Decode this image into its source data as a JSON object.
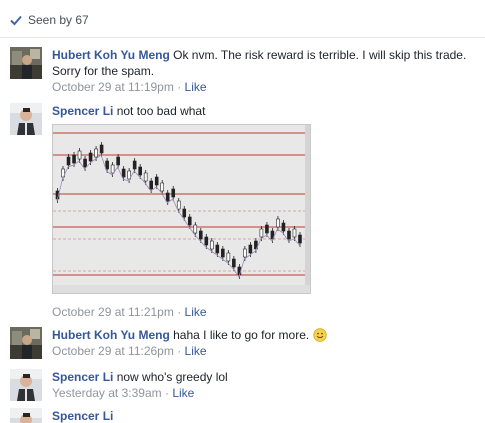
{
  "seen": {
    "label": "Seen by 67",
    "icon": "checkmark-icon"
  },
  "comments": [
    {
      "author": "Hubert Koh Yu Meng",
      "text": "Ok nvm. The risk reward is terrible. I will skip this trade. Sorry for the spam.",
      "time": "October 29 at 11:19pm",
      "like": "Like"
    },
    {
      "author": "Spencer Li",
      "text": "not too bad what",
      "time": "October 29 at 11:21pm",
      "like": "Like"
    },
    {
      "author": "Hubert Koh Yu Meng",
      "text": "haha I like to go for more.",
      "time": "October 29 at 11:26pm",
      "like": "Like",
      "emoji": "smiley-emoji"
    },
    {
      "author": "Spencer Li",
      "text": "now who's greedy lol",
      "time": "Yesterday at 3:39am",
      "like": "Like"
    },
    {
      "author": "Spencer Li",
      "text": "",
      "time": "",
      "like": ""
    }
  ],
  "separator": "·",
  "colors": {
    "link": "#365899",
    "meta": "#90949c",
    "text": "#1d2129",
    "chart_bg": "#e9e9e9",
    "chart_lines": "#c0392b"
  }
}
